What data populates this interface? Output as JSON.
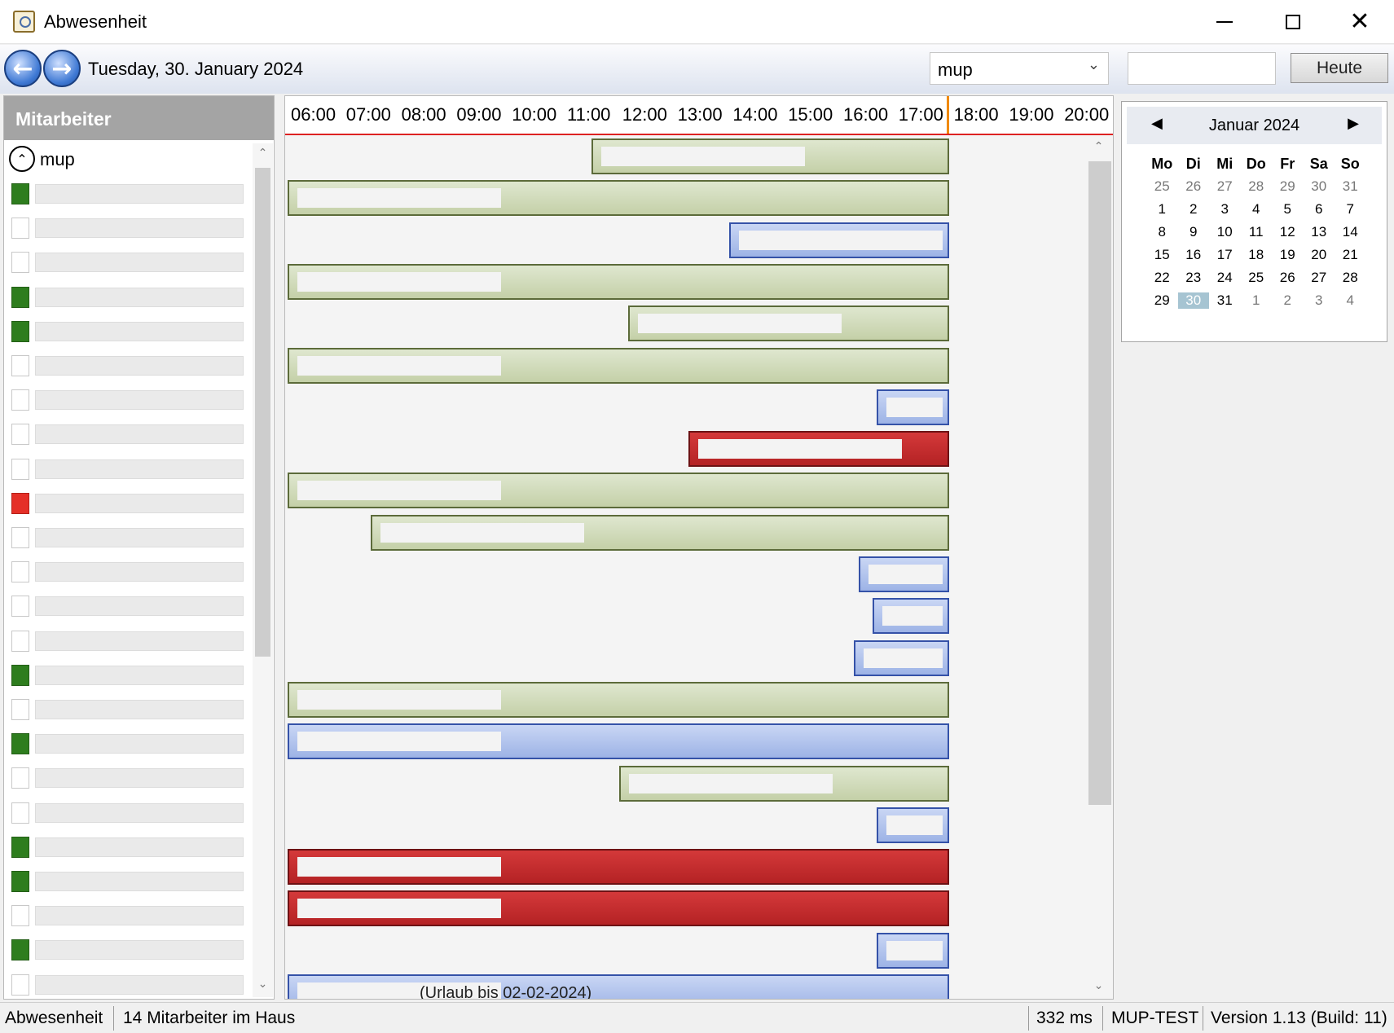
{
  "window": {
    "title": "Abwesenheit"
  },
  "toolbar": {
    "date_label": "Tuesday, 30. January 2024",
    "user_value": "mup",
    "search_value": "",
    "today_label": "Heute"
  },
  "left_panel": {
    "header": "Mitarbeiter",
    "group_label": "mup",
    "employees": [
      {
        "status": "in"
      },
      {
        "status": "none"
      },
      {
        "status": "none"
      },
      {
        "status": "in"
      },
      {
        "status": "in"
      },
      {
        "status": "none"
      },
      {
        "status": "none"
      },
      {
        "status": "none"
      },
      {
        "status": "none"
      },
      {
        "status": "sick"
      },
      {
        "status": "none"
      },
      {
        "status": "none"
      },
      {
        "status": "none"
      },
      {
        "status": "none"
      },
      {
        "status": "in"
      },
      {
        "status": "none"
      },
      {
        "status": "in"
      },
      {
        "status": "none"
      },
      {
        "status": "none"
      },
      {
        "status": "in"
      },
      {
        "status": "in"
      },
      {
        "status": "none"
      },
      {
        "status": "in"
      },
      {
        "status": "none"
      }
    ]
  },
  "timeline": {
    "hours": [
      "06:00",
      "07:00",
      "08:00",
      "09:00",
      "10:00",
      "11:00",
      "12:00",
      "13:00",
      "14:00",
      "15:00",
      "16:00",
      "17:00",
      "18:00",
      "19:00",
      "20:00"
    ],
    "current_time": "17:30",
    "bars": [
      {
        "type": "green",
        "start": "11:30"
      },
      {
        "type": "green",
        "start": "06:00"
      },
      {
        "type": "blue",
        "start": "14:00"
      },
      {
        "type": "green",
        "start": "06:00"
      },
      {
        "type": "green",
        "start": "12:10"
      },
      {
        "type": "green",
        "start": "06:00"
      },
      {
        "type": "blue",
        "start": "16:40"
      },
      {
        "type": "red",
        "start": "13:15"
      },
      {
        "type": "green",
        "start": "06:00"
      },
      {
        "type": "green",
        "start": "07:30"
      },
      {
        "type": "blue",
        "start": "16:20"
      },
      {
        "type": "blue",
        "start": "16:35"
      },
      {
        "type": "blue",
        "start": "16:15"
      },
      {
        "type": "green",
        "start": "06:00"
      },
      {
        "type": "blue",
        "start": "06:00"
      },
      {
        "type": "green",
        "start": "12:00"
      },
      {
        "type": "blue",
        "start": "16:40"
      },
      {
        "type": "red",
        "start": "06:00"
      },
      {
        "type": "red",
        "start": "06:00"
      },
      {
        "type": "blue",
        "start": "16:40"
      },
      {
        "type": "blue",
        "start": "06:00",
        "note": "(Urlaub bis 02-02-2024)"
      }
    ]
  },
  "calendar": {
    "title": "Januar 2024",
    "weekdays": [
      "Mo",
      "Di",
      "Mi",
      "Do",
      "Fr",
      "Sa",
      "So"
    ],
    "weeks": [
      [
        {
          "d": "25",
          "o": true
        },
        {
          "d": "26",
          "o": true
        },
        {
          "d": "27",
          "o": true
        },
        {
          "d": "28",
          "o": true
        },
        {
          "d": "29",
          "o": true
        },
        {
          "d": "30",
          "o": true
        },
        {
          "d": "31",
          "o": true
        }
      ],
      [
        {
          "d": "1"
        },
        {
          "d": "2"
        },
        {
          "d": "3"
        },
        {
          "d": "4"
        },
        {
          "d": "5"
        },
        {
          "d": "6"
        },
        {
          "d": "7"
        }
      ],
      [
        {
          "d": "8"
        },
        {
          "d": "9"
        },
        {
          "d": "10"
        },
        {
          "d": "11"
        },
        {
          "d": "12"
        },
        {
          "d": "13"
        },
        {
          "d": "14"
        }
      ],
      [
        {
          "d": "15"
        },
        {
          "d": "16"
        },
        {
          "d": "17"
        },
        {
          "d": "18"
        },
        {
          "d": "19"
        },
        {
          "d": "20"
        },
        {
          "d": "21"
        }
      ],
      [
        {
          "d": "22"
        },
        {
          "d": "23"
        },
        {
          "d": "24"
        },
        {
          "d": "25"
        },
        {
          "d": "26"
        },
        {
          "d": "27"
        },
        {
          "d": "28"
        }
      ],
      [
        {
          "d": "29"
        },
        {
          "d": "30",
          "sel": true
        },
        {
          "d": "31"
        },
        {
          "d": "1",
          "o": true
        },
        {
          "d": "2",
          "o": true
        },
        {
          "d": "3",
          "o": true
        },
        {
          "d": "4",
          "o": true
        }
      ]
    ]
  },
  "statusbar": {
    "module": "Abwesenheit",
    "present_count": "14 Mitarbeiter im Haus",
    "latency": "332 ms",
    "server": "MUP-TEST",
    "version": "Version 1.13 (Build: 11)"
  },
  "colors": {
    "present": "#2e7d1e",
    "sick": "#e53028",
    "now_marker": "#f08a00",
    "header_line": "#dd2222"
  },
  "icons": {
    "back": "arrow-left-icon",
    "forward": "arrow-right-icon",
    "collapse": "chevron-up-icon",
    "dropdown": "chevron-down-icon"
  }
}
